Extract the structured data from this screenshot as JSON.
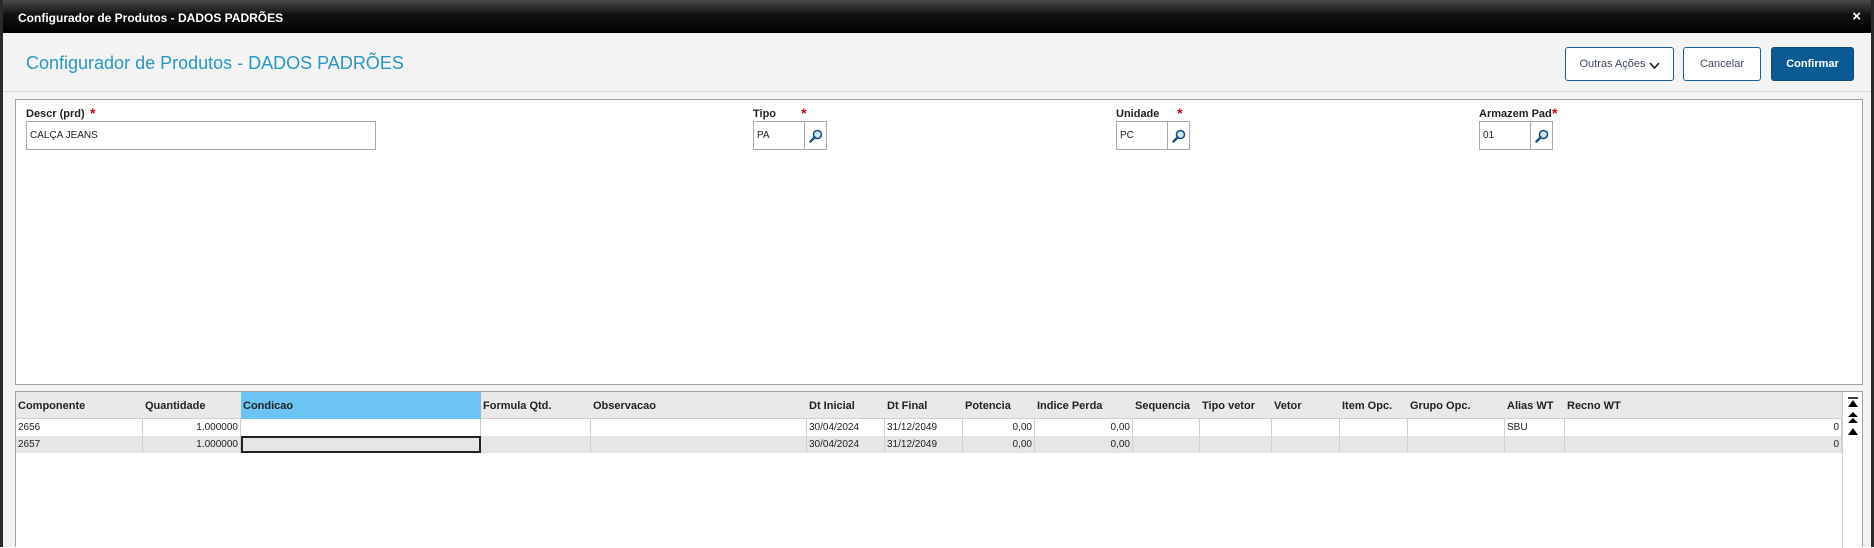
{
  "window": {
    "title": "Configurador de Produtos - DADOS PADRÕES",
    "close_glyph": "×"
  },
  "header": {
    "title": "Configurador de Produtos - DADOS PADRÕES",
    "buttons": {
      "more_actions": "Outras Ações",
      "cancel": "Cancelar",
      "confirm": "Confirmar"
    }
  },
  "form": {
    "descr": {
      "label": "Descr (prd)",
      "value": "CALÇA JEANS"
    },
    "tipo": {
      "label": "Tipo",
      "value": "PA"
    },
    "unidade": {
      "label": "Unidade",
      "value": "PC"
    },
    "armazem": {
      "label": "Armazem Pad",
      "value": "01"
    },
    "required_marker": "*"
  },
  "grid": {
    "columns": [
      "Componente",
      "Quantidade",
      "Condicao",
      "Formula Qtd.",
      "Observacao",
      "Dt Inicial",
      "Dt Final",
      "Potencia",
      "Indice Perda",
      "Sequencia",
      "Tipo vetor",
      "Vetor",
      "Item Opc.",
      "Grupo Opc.",
      "Alias WT",
      "Recno WT"
    ],
    "selected_column": "Condicao",
    "rows": [
      [
        "2656",
        "1.000000",
        "",
        "",
        "",
        "30/04/2024",
        "31/12/2049",
        "0,00",
        "0,00",
        "",
        "",
        "",
        "",
        "",
        "SBU",
        "0"
      ],
      [
        "2657",
        "1.000000",
        "",
        "",
        "",
        "30/04/2024",
        "31/12/2049",
        "0,00",
        "0,00",
        "",
        "",
        "",
        "",
        "",
        "",
        "0"
      ]
    ]
  },
  "icons": {
    "lookup": "magnifier-icon",
    "close": "close-icon",
    "chevron": "chevron-down-icon"
  },
  "colors": {
    "title_blue": "#2a97c5",
    "primary_button": "#0c5a94",
    "selected_header": "#6cc4f5",
    "required": "#d20000"
  }
}
